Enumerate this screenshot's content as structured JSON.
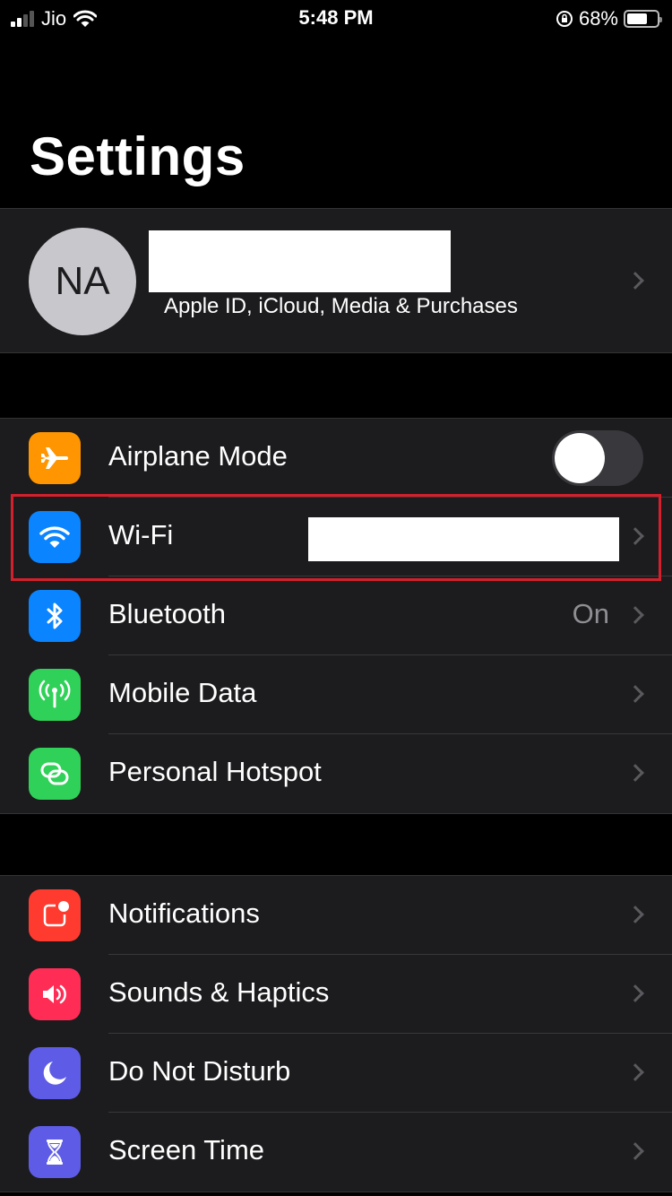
{
  "status_bar": {
    "carrier": "Jio",
    "time": "5:48 PM",
    "battery_percent": "68%",
    "battery_level": 0.68,
    "icons": [
      "cellular-signal-icon",
      "wifi-icon",
      "orientation-lock-icon",
      "battery-icon"
    ]
  },
  "header": {
    "title": "Settings"
  },
  "profile": {
    "initials": "NA",
    "name": "",
    "subtitle": "Apple ID, iCloud, Media & Purchases"
  },
  "groups": [
    {
      "items": [
        {
          "label": "Airplane Mode",
          "icon": "airplane-icon",
          "color": "#ff9500",
          "toggle": false
        },
        {
          "label": "Wi-Fi",
          "icon": "wifi-icon",
          "color": "#0a84ff",
          "value": "",
          "highlighted": true
        },
        {
          "label": "Bluetooth",
          "icon": "bluetooth-icon",
          "color": "#0a84ff",
          "value": "On"
        },
        {
          "label": "Mobile Data",
          "icon": "antenna-icon",
          "color": "#30d158"
        },
        {
          "label": "Personal Hotspot",
          "icon": "hotspot-link-icon",
          "color": "#30d158"
        }
      ]
    },
    {
      "items": [
        {
          "label": "Notifications",
          "icon": "notifications-icon",
          "color": "#ff3b30"
        },
        {
          "label": "Sounds & Haptics",
          "icon": "speaker-icon",
          "color": "#ff2d55"
        },
        {
          "label": "Do Not Disturb",
          "icon": "moon-icon",
          "color": "#5e5ce6"
        },
        {
          "label": "Screen Time",
          "icon": "hourglass-icon",
          "color": "#5e5ce6"
        }
      ]
    }
  ]
}
